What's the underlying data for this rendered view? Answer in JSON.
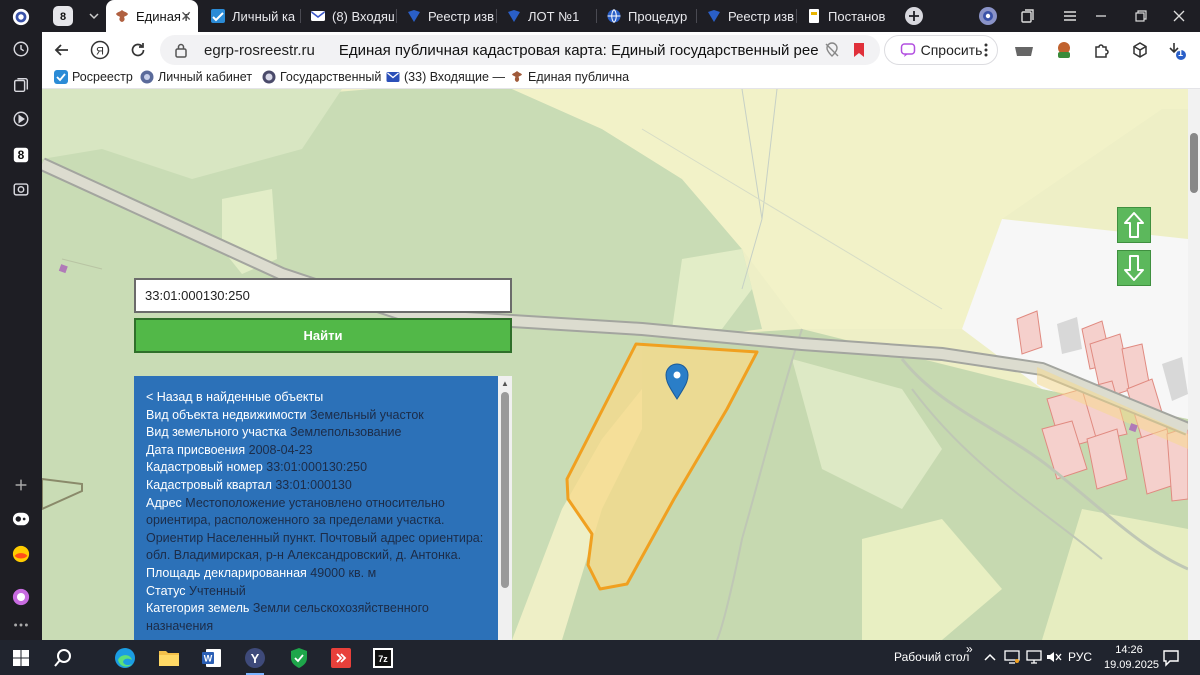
{
  "tabs": [
    {
      "label": "Единая г",
      "active": true
    },
    {
      "label": "Личный ка",
      "active": false
    },
    {
      "label": "(8) Входящ",
      "active": false
    },
    {
      "label": "Реестр изв",
      "active": false
    },
    {
      "label": "ЛОТ №1",
      "active": false
    },
    {
      "label": "Процедур",
      "active": false
    },
    {
      "label": "Реестр изв",
      "active": false
    },
    {
      "label": "Постанов",
      "active": false
    }
  ],
  "sidebar_badge": "8",
  "address_bar": {
    "host": "egrp-rosreestr.ru",
    "page_title": "Единая публичная кадастровая карта: Единый государственный реест…",
    "ask_label": "Спросить",
    "extension_badge": "1"
  },
  "bookmarks": [
    {
      "label": "Росреестр"
    },
    {
      "label": "Личный кабинет"
    },
    {
      "label": "Государственный"
    },
    {
      "label": "(33) Входящие —"
    },
    {
      "label": "Единая публична"
    }
  ],
  "search": {
    "value": "33:01:000130:250",
    "button_label": "Найти"
  },
  "info": {
    "back_link": "< Назад в найденные объекты",
    "rows": [
      {
        "key": "Вид объекта недвижимости",
        "value": "Земельный участок"
      },
      {
        "key": "Вид земельного участка",
        "value": "Землепользование"
      },
      {
        "key": "Дата присвоения",
        "value": "2008-04-23"
      },
      {
        "key": "Кадастровый номер",
        "value": "33:01:000130:250"
      },
      {
        "key": "Кадастровый квартал",
        "value": "33:01:000130"
      },
      {
        "key": "Адрес",
        "value": "Местоположение установлено относительно ориентира, расположенного за пределами участка. Ориентир Населенный пункт. Почтовый адрес ориентира: обл. Владимирская, р-н Александровский, д. Антонка."
      },
      {
        "key": "Площадь декларированная",
        "value": "49000 кв. м"
      },
      {
        "key": "Статус",
        "value": "Учтенный"
      },
      {
        "key": "Категория земель",
        "value": "Земли сельскохозяйственного назначения"
      }
    ]
  },
  "taskbar": {
    "desktop_label": "Рабочий стол",
    "chevron": "»",
    "language": "РУС",
    "time": "14:26",
    "date": "19.09.2025"
  },
  "colors": {
    "parcel_fill": "#f7d98a",
    "parcel_stroke": "#f0a020",
    "panel": "#2c71b8",
    "button_green": "#52b848",
    "marker": "#2a7ec8"
  }
}
